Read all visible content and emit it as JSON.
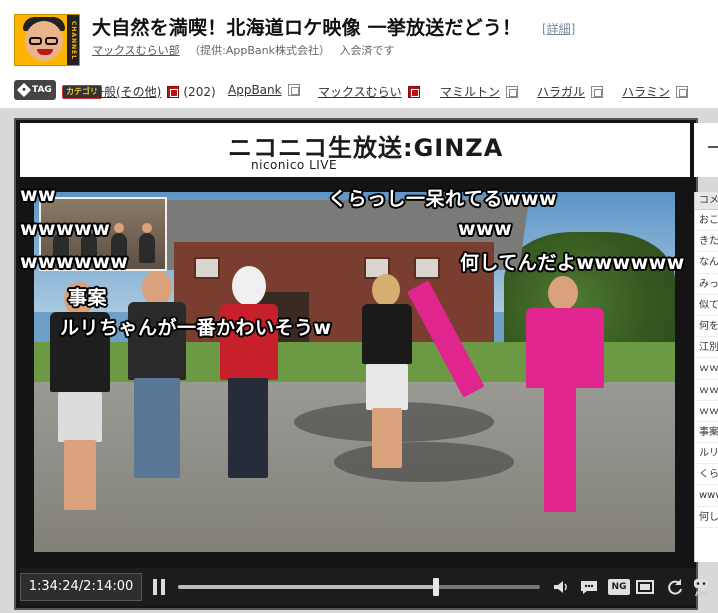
{
  "header": {
    "avatar_caption": "CHANNEL",
    "title": "大自然を満喫！北海道ロケ映像 一挙放送だどう！",
    "detail_link": "[詳細]",
    "channel_name": "マックスむらい部",
    "provider": "（提供:AppBank株式会社）",
    "member_status": "入会済です"
  },
  "tagbar": {
    "tag_badge": "TAG",
    "category_badge": "カテゴリ",
    "tags": [
      {
        "label": "一般(その他)",
        "icon": "dictionary-icon-red",
        "count": "(202)"
      },
      {
        "label": "AppBank",
        "icon": "dictionary-icon"
      },
      {
        "label": "マックスむらい",
        "icon": "dictionary-icon-red"
      },
      {
        "label": "マミルトン",
        "icon": "dictionary-icon"
      },
      {
        "label": "ハラガル",
        "icon": "dictionary-icon"
      },
      {
        "label": "ハラミン",
        "icon": "dictionary-icon"
      }
    ]
  },
  "player": {
    "brand_main": "ニコニコ生放送:GINZA",
    "brand_sub": "niconico LIVE",
    "comments": [
      {
        "text": "ww"
      },
      {
        "text": "wwwww"
      },
      {
        "text": "wwwwww"
      },
      {
        "text": "事案"
      },
      {
        "text": "ルリちゃんが一番かわいそうw"
      },
      {
        "text": "くらっし一呆れてるwww"
      },
      {
        "text": "www"
      },
      {
        "text": "何してんだよwwwwww"
      }
    ],
    "comment_panel": {
      "header": "コメ",
      "rows": [
        "おこ",
        "きた",
        "なん",
        "みっ",
        "似て",
        "何を",
        "江別",
        "ｗｗ",
        "ｗｗ",
        "ｗｗ",
        "事案",
        "ルリ",
        "くら",
        "www",
        "何し"
      ]
    },
    "controls": {
      "time_display": "1:34:24/2:14:00",
      "seek_progress": 0.704,
      "nq_label": "NG",
      "app_label": "APP"
    }
  },
  "colors": {
    "header_bg": "#ffffff",
    "player_bg": "#141414",
    "controls_bg": "#1c1c1c",
    "accent_red": "#b41616",
    "comment_text": "#ffffff"
  }
}
